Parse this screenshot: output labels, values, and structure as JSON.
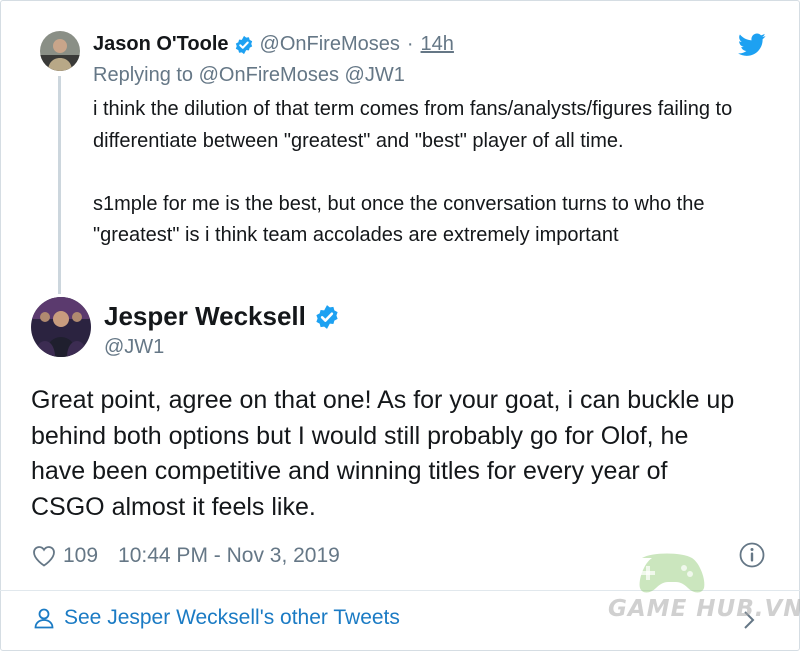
{
  "reply_tweet": {
    "author_name": "Jason O'Toole",
    "author_handle": "@OnFireMoses",
    "separator": "·",
    "time": "14h",
    "replying_prefix": "Replying to",
    "replying_mentions": "@OnFireMoses @JW1",
    "paragraph_1": "i think the dilution of that term comes from fans/analysts/figures failing to differentiate between \"greatest\" and \"best\" player of all time.",
    "paragraph_2": "s1mple for me is the best, but once the conversation turns to who the \"greatest\" is i think team accolades are extremely important",
    "avatar_icon": "person-avatar"
  },
  "main_tweet": {
    "author_name": "Jesper Wecksell",
    "author_handle": "@JW1",
    "text_lines": [
      "Great point, agree on that one! As for your goat, i can buckle up",
      "behind both options but I would still probably go for Olof, he",
      "have been competitive and winning titles for every year of",
      "CSGO almost it feels like."
    ],
    "likes": "109",
    "timestamp": "10:44 PM - Nov 3, 2019",
    "avatar_icon": "person-avatar"
  },
  "footer": {
    "link_label": "See Jesper Wecksell's other Tweets"
  },
  "watermark": {
    "text": "GAME HUB.VN",
    "icon": "gamepad-icon"
  },
  "icons": {
    "brand": "twitter-bird-icon",
    "verified": "verified-badge-icon",
    "like": "heart-icon",
    "info": "info-icon",
    "user": "user-icon",
    "chevron": "chevron-right-icon"
  },
  "colors": {
    "twitter_blue": "#1da1f2",
    "link_blue": "#1b7bc4",
    "secondary_text": "#657786",
    "primary_text": "#14171a",
    "thread_line": "#ccd6dd"
  }
}
